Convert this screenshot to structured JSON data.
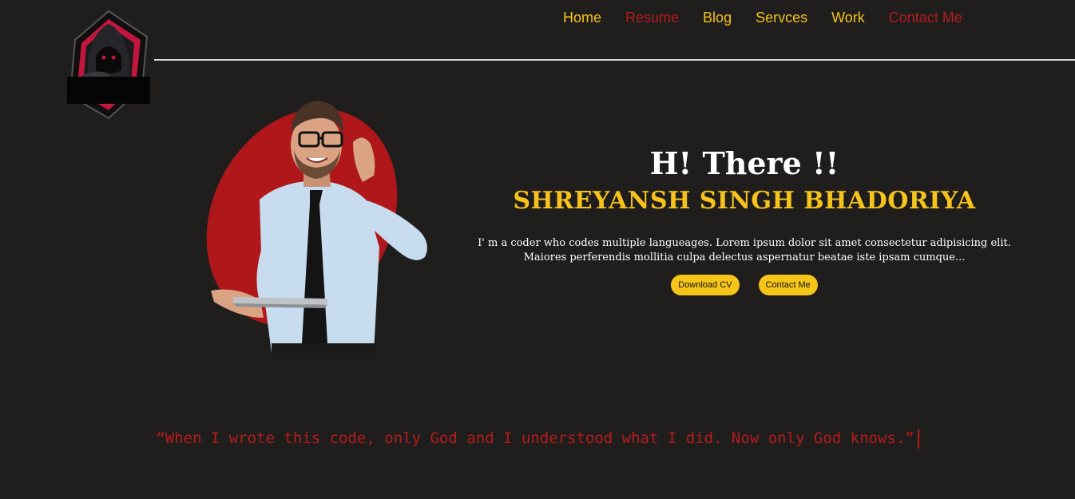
{
  "nav": {
    "items": [
      {
        "label": "Home",
        "color": "#f5c31b"
      },
      {
        "label": "Resume",
        "color": "#b51d1d"
      },
      {
        "label": "Blog",
        "color": "#f5c31b"
      },
      {
        "label": "Servces",
        "color": "#f5c31b"
      },
      {
        "label": "Work",
        "color": "#f5c31b"
      },
      {
        "label": "Contact Me",
        "color": "#b51d1d"
      }
    ]
  },
  "hero": {
    "greeting": "H! There !!",
    "name": "SHREYANSH SINGH BHADORIYA",
    "bio": "I' m a coder who codes multiple langueages. Lorem ipsum dolor sit amet consectetur adipisicing elit. Maiores perferendis mollitia culpa delectus aspernatur beatae iste ipsam cumque...",
    "buttons": {
      "download": "Download CV",
      "contact": "Contact Me"
    },
    "image_icon": "businessman-with-laptop-icon"
  },
  "quote": {
    "text": "“When I wrote this code, only God and I understood what I did. Now only God knows.”"
  },
  "colors": {
    "background": "#201d1d",
    "accent_yellow": "#f5c31b",
    "accent_red": "#b51d1d"
  },
  "logo_icon": "hooded-hacker-logo-icon"
}
